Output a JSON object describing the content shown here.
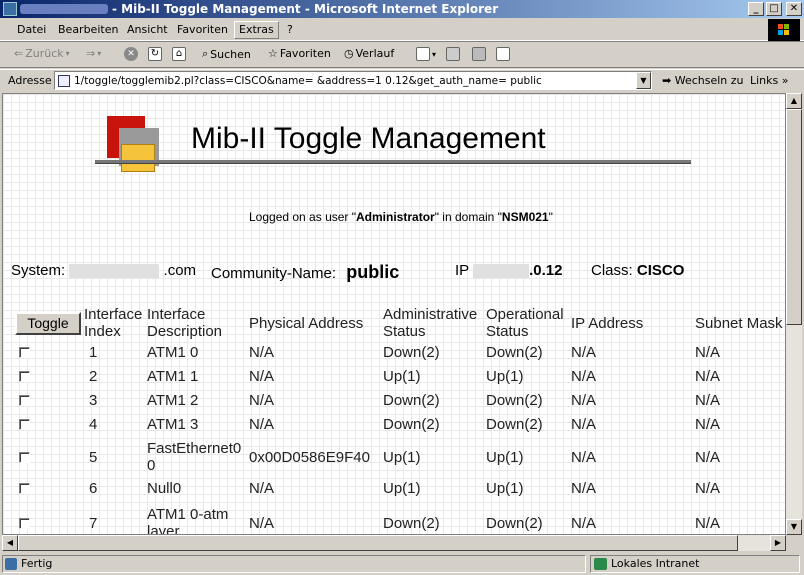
{
  "window": {
    "title": "- Mib-II Toggle Management - Microsoft Internet Explorer",
    "min_label": "_",
    "max_label": "□",
    "close_label": "✕"
  },
  "menu": [
    "Datei",
    "Bearbeiten",
    "Ansicht",
    "Favoriten",
    "Extras",
    "?"
  ],
  "toolbar": {
    "back": "Zurück",
    "search": "Suchen",
    "favorites": "Favoriten",
    "history": "Verlauf"
  },
  "address": {
    "label": "Adresse",
    "url": "1/toggle/togglemib2.pl?class=CISCO&name=                    &address=1            0.12&get_auth_name= public",
    "go": "Wechseln zu",
    "links": "Links"
  },
  "page": {
    "title": "Mib-II Toggle Management",
    "logged_prefix": "Logged on as user \"",
    "user": "Administrator",
    "logged_mid": "\" in domain \"",
    "domain": "NSM021",
    "logged_suffix": "\"",
    "system_label": "System:",
    "system_value": "        .com",
    "community_label": "Community-Name:",
    "community_value": "public",
    "ip_label": "IP",
    "ip_value": ".0.12",
    "class_label": "Class:",
    "class_value": "CISCO",
    "toggle_button": "Toggle"
  },
  "table": {
    "headers": {
      "index": [
        "Interface",
        "Index"
      ],
      "description": [
        "Interface",
        "Description"
      ],
      "physical": [
        "Physical Address"
      ],
      "admin": [
        "Administrative",
        "Status"
      ],
      "oper": [
        "Operational",
        "Status"
      ],
      "ip": [
        "IP Address"
      ],
      "mask": [
        "Subnet Mask"
      ]
    },
    "rows": [
      {
        "index": "1",
        "desc": [
          "ATM1 0"
        ],
        "phys": "N/A",
        "admin": "Down(2)",
        "oper": "Down(2)",
        "ip": "N/A",
        "mask": "N/A"
      },
      {
        "index": "2",
        "desc": [
          "ATM1 1"
        ],
        "phys": "N/A",
        "admin": "Up(1)",
        "oper": "Up(1)",
        "ip": "N/A",
        "mask": "N/A"
      },
      {
        "index": "3",
        "desc": [
          "ATM1 2"
        ],
        "phys": "N/A",
        "admin": "Down(2)",
        "oper": "Down(2)",
        "ip": "N/A",
        "mask": "N/A"
      },
      {
        "index": "4",
        "desc": [
          "ATM1 3"
        ],
        "phys": "N/A",
        "admin": "Down(2)",
        "oper": "Down(2)",
        "ip": "N/A",
        "mask": "N/A"
      },
      {
        "index": "5",
        "desc": [
          "FastEthernet0",
          "0"
        ],
        "phys": "0x00D0586E9F40",
        "admin": "Up(1)",
        "oper": "Up(1)",
        "ip": "N/A",
        "mask": "N/A"
      },
      {
        "index": "6",
        "desc": [
          "Null0"
        ],
        "phys": "N/A",
        "admin": "Up(1)",
        "oper": "Up(1)",
        "ip": "N/A",
        "mask": "N/A"
      },
      {
        "index": "7",
        "desc": [
          "ATM1 0-atm",
          "layer"
        ],
        "phys": "N/A",
        "admin": "Down(2)",
        "oper": "Down(2)",
        "ip": "N/A",
        "mask": "N/A"
      }
    ]
  },
  "status": {
    "text": "Fertig",
    "zone": "Lokales Intranet"
  }
}
